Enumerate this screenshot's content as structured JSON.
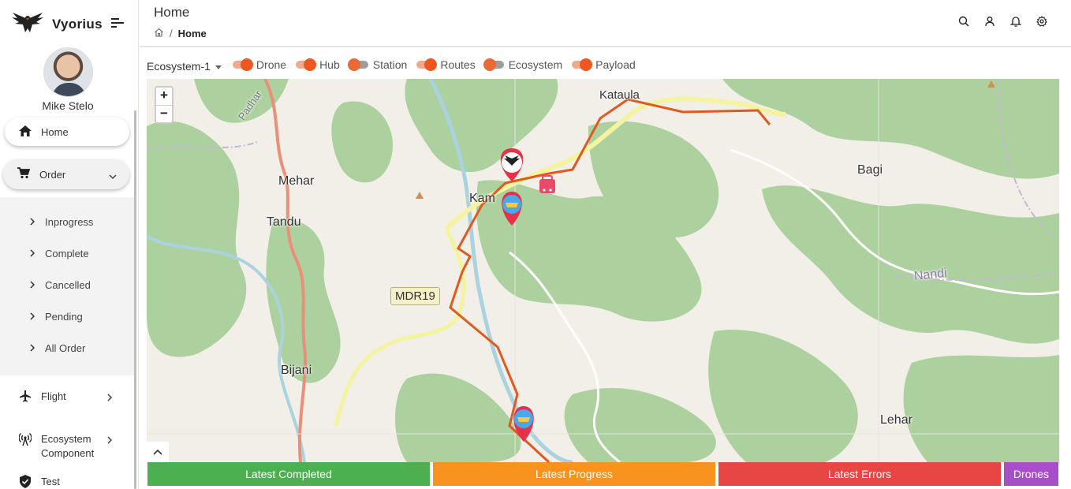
{
  "app": {
    "name": "Vyorius"
  },
  "user": {
    "name": "Mike Stelo"
  },
  "sidebar": {
    "home": "Home",
    "order": "Order",
    "order_items": [
      "Inprogress",
      "Complete",
      "Cancelled",
      "Pending",
      "All Order"
    ],
    "flight": "Flight",
    "ecosystem_component": "Ecosystem Component",
    "test": "Test"
  },
  "header": {
    "title": "Home",
    "breadcrumb": {
      "separator": "/",
      "current": "Home"
    },
    "icons": [
      "search-icon",
      "user-icon",
      "bell-icon",
      "gear-icon"
    ]
  },
  "filters": {
    "ecosystem_select": "Ecosystem-1",
    "toggles": [
      {
        "label": "Drone",
        "on": true
      },
      {
        "label": "Hub",
        "on": true
      },
      {
        "label": "Station",
        "on": false
      },
      {
        "label": "Routes",
        "on": true
      },
      {
        "label": "Ecosystem",
        "on": false
      },
      {
        "label": "Payload",
        "on": true
      }
    ]
  },
  "map": {
    "zoom_in": "+",
    "zoom_out": "−",
    "places": {
      "kataula": "Kataula",
      "bagi": "Bagi",
      "mehar": "Mehar",
      "tandu": "Tandu",
      "kamand": "Kam",
      "nandi": "Nandi",
      "bijani": "Bijani",
      "lehar": "Lehar",
      "padhar": "Padhar"
    },
    "road_tag": "MDR19"
  },
  "status_bar": {
    "completed": "Latest Completed",
    "progress": "Latest Progress",
    "errors": "Latest Errors",
    "drones": "Drones"
  },
  "colors": {
    "accent": "#ee5722",
    "route": "#e0591f",
    "completed": "#4caf50",
    "progress": "#f7931e",
    "errors": "#e84545",
    "drones": "#a64fc9"
  }
}
